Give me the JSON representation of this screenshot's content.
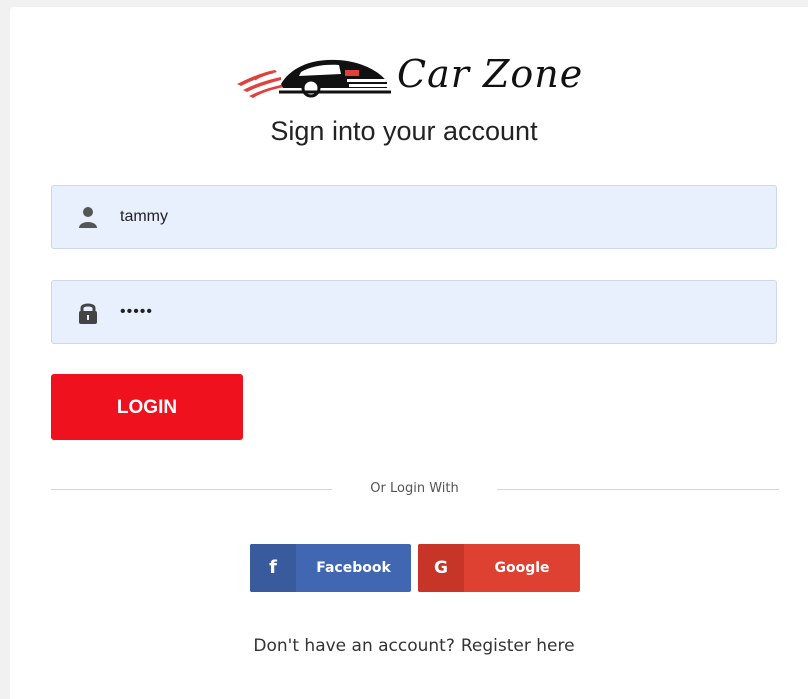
{
  "brand": {
    "name": "Car Zone",
    "icon": "car-logo-icon"
  },
  "heading": "Sign into your account",
  "form": {
    "username": {
      "value": "tammy",
      "icon": "user-icon"
    },
    "password": {
      "value": "•••••",
      "icon": "lock-icon"
    },
    "login_label": "LOGIN"
  },
  "divider": {
    "text": "Or Login With"
  },
  "social": {
    "facebook": {
      "label": "Facebook",
      "glyph": "f",
      "color": "#4267b2"
    },
    "google": {
      "label": "Google",
      "glyph": "G",
      "color": "#de4132"
    }
  },
  "footer": {
    "prompt": "Don't have an account?",
    "register_link": "Register here"
  },
  "colors": {
    "accent": "#f0111e",
    "field_bg": "#e8f0fe"
  }
}
